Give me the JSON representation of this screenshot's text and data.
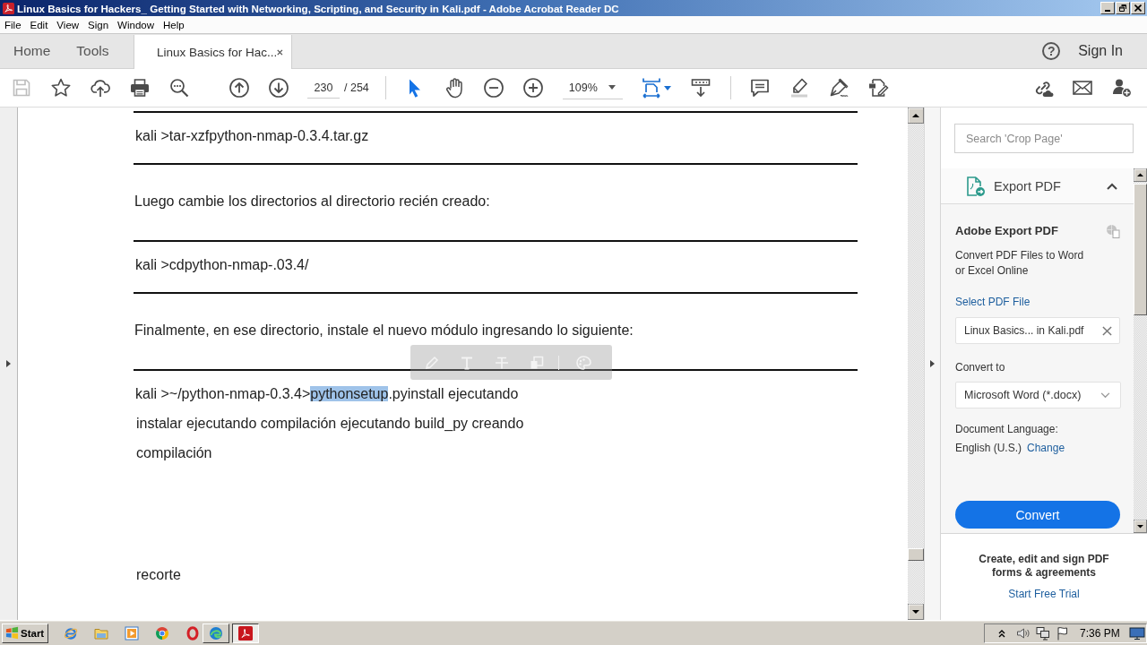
{
  "window": {
    "title": "Linux Basics for Hackers_ Getting Started with Networking, Scripting, and Security in Kali.pdf - Adobe Acrobat Reader DC"
  },
  "menu": [
    "File",
    "Edit",
    "View",
    "Sign",
    "Window",
    "Help"
  ],
  "tabs": [
    {
      "kind": "nav",
      "label": "Home",
      "selected": false
    },
    {
      "kind": "nav",
      "label": "Tools",
      "selected": false
    },
    {
      "kind": "document",
      "label": "Linux Basics for Hac...",
      "selected": true
    }
  ],
  "account": {
    "help": "?",
    "sign_in": "Sign In"
  },
  "toolbar": {
    "save": {
      "disabled": true
    },
    "page_number": "230",
    "page_total": "/ 254",
    "tools": [
      {
        "selected": true
      },
      {
        "selected": false
      }
    ],
    "zoom": "109%"
  },
  "document": {
    "lines": [
      {
        "kind": "rule"
      },
      {
        "kind": "command",
        "segments": [
          {
            "text": "kali >tar-xzfpython-nmap-0.3.4.tar.gz",
            "selected": false
          }
        ]
      },
      {
        "kind": "rule"
      },
      {
        "kind": "prose",
        "segments": [
          {
            "text": "Luego cambie los directorios al directorio recién creado:",
            "selected": false
          }
        ]
      },
      {
        "kind": "rule"
      },
      {
        "kind": "command",
        "segments": [
          {
            "text": "kali >cdpython-nmap-.03.4/",
            "selected": false
          }
        ]
      },
      {
        "kind": "rule"
      },
      {
        "kind": "prose",
        "segments": [
          {
            "text": "Finalmente, en ese directorio, instale el nuevo módulo ingresando lo siguiente:",
            "selected": false
          }
        ]
      },
      {
        "kind": "rule"
      },
      {
        "kind": "command",
        "segments": [
          {
            "text": "kali >~/python-nmap-0.3.4>",
            "selected": false
          },
          {
            "text": "pythonsetup",
            "selected": true
          },
          {
            "text": ".pyinstall ejecutando",
            "selected": false
          }
        ]
      },
      {
        "kind": "output",
        "segments": [
          {
            "text": "instalar ejecutando compilación ejecutando build_py creando",
            "selected": false
          }
        ]
      },
      {
        "kind": "output",
        "segments": [
          {
            "text": "compilación",
            "selected": false
          }
        ]
      },
      {
        "kind": "note",
        "segments": [
          {
            "text": "recorte",
            "selected": false
          }
        ]
      }
    ]
  },
  "right_panel": {
    "search": {
      "placeholder": "Search 'Crop Page'"
    },
    "export_pdf": {
      "title": "Export PDF",
      "expanded": true,
      "heading": "Adobe Export PDF",
      "description": "Convert PDF Files to Word or Excel Online",
      "select_file_link": "Select PDF File",
      "file_name": "Linux Basics... in Kali.pdf",
      "convert_to_label": "Convert to",
      "format": "Microsoft Word (*.docx)",
      "language_label": "Document Language:",
      "language": "English (U.S.)",
      "change_link": "Change",
      "convert_button": "Convert"
    },
    "promo": {
      "text": "Create, edit and sign PDF forms & agreements",
      "link": "Start Free Trial"
    }
  },
  "taskbar": {
    "start": "Start",
    "tasks": [
      {
        "selected": false
      },
      {
        "selected": true
      }
    ],
    "clock": "7:36 PM"
  }
}
